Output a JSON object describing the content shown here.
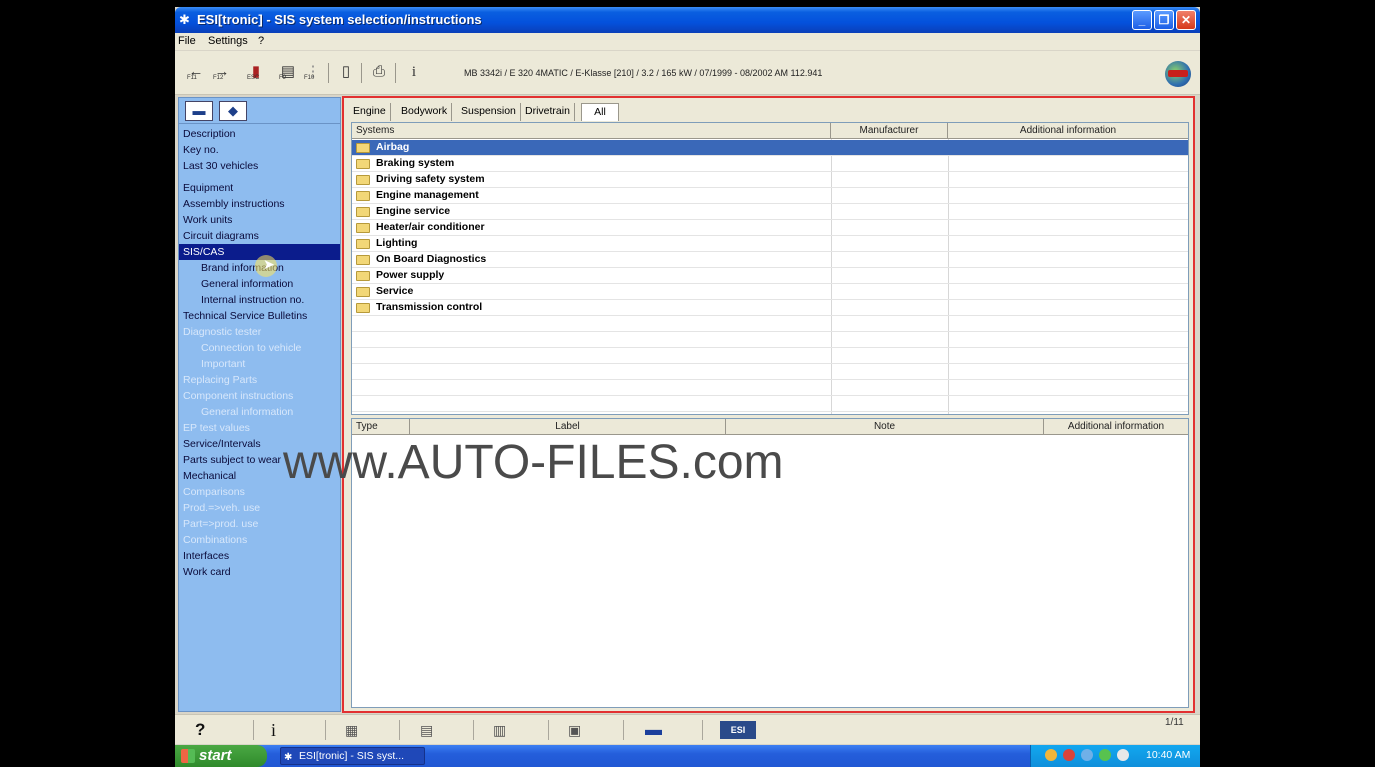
{
  "window": {
    "title": "ESI[tronic] - SIS system selection/instructions",
    "controls": {
      "minimize": "_",
      "maximize": "❐",
      "close": "✕"
    }
  },
  "menu": [
    "File",
    "Settings",
    "?"
  ],
  "toolbar": {
    "back_key": "F11",
    "forward_key": "F12",
    "esc_key": "ESC",
    "f9_key": "F9",
    "f10_key": "F10",
    "info_label": "i",
    "vehicle_info": "MB 3342i / E 320 4MATIC / E-Klasse [210] / 3.2 / 165 kW / 07/1999 - 08/2002 AM 112.941"
  },
  "sidebar": {
    "items": [
      {
        "label": "Description",
        "state": "on"
      },
      {
        "label": "Key no.",
        "state": "on"
      },
      {
        "label": "Last 30 vehicles",
        "state": "on"
      },
      {
        "label": "Equipment",
        "state": "on"
      },
      {
        "label": "Assembly instructions",
        "state": "on"
      },
      {
        "label": "Work units",
        "state": "on"
      },
      {
        "label": "Circuit diagrams",
        "state": "on"
      },
      {
        "label": "SIS/CAS",
        "state": "selected"
      },
      {
        "label": "Brand information",
        "state": "sub"
      },
      {
        "label": "General information",
        "state": "sub"
      },
      {
        "label": "Internal instruction no.",
        "state": "sub"
      },
      {
        "label": "Technical Service Bulletins",
        "state": "on"
      },
      {
        "label": "Diagnostic tester",
        "state": "off"
      },
      {
        "label": "Connection to vehicle",
        "state": "off-sub"
      },
      {
        "label": "Important",
        "state": "off-sub"
      },
      {
        "label": "Replacing Parts",
        "state": "off"
      },
      {
        "label": "Component instructions",
        "state": "off"
      },
      {
        "label": "General information",
        "state": "off-sub"
      },
      {
        "label": "EP test values",
        "state": "off"
      },
      {
        "label": "Service/Intervals",
        "state": "on"
      },
      {
        "label": "Parts subject to wear",
        "state": "on"
      },
      {
        "label": "Mechanical",
        "state": "on"
      },
      {
        "label": "Comparisons",
        "state": "off"
      },
      {
        "label": "Prod.=>veh. use",
        "state": "off"
      },
      {
        "label": "Part=>prod. use",
        "state": "off"
      },
      {
        "label": "Combinations",
        "state": "off"
      },
      {
        "label": "Interfaces",
        "state": "on"
      },
      {
        "label": "Work card",
        "state": "on"
      }
    ]
  },
  "main": {
    "tabs": [
      "Engine",
      "Bodywork",
      "Suspension",
      "Drivetrain",
      "All"
    ],
    "active_tab": "All",
    "systems_table": {
      "headers": [
        "Systems",
        "Manufacturer",
        "Additional information"
      ],
      "rows": [
        "Airbag",
        "Braking system",
        "Driving safety system",
        "Engine management",
        "Engine service",
        "Heater/air conditioner",
        "Lighting",
        "On Board Diagnostics",
        "Power supply",
        "Service",
        "Transmission control"
      ],
      "selected_row": "Airbag"
    },
    "detail_table": {
      "headers": [
        "Type",
        "Label",
        "Note",
        "Additional information"
      ]
    }
  },
  "watermark": "www.AUTO-FILES.com",
  "bottombar": {
    "help_label": "?",
    "info_label": "i",
    "page_count": "1/11"
  },
  "taskbar": {
    "start_label": "start",
    "task_item": "ESI[tronic] - SIS syst...",
    "clock": "10:40 AM"
  }
}
